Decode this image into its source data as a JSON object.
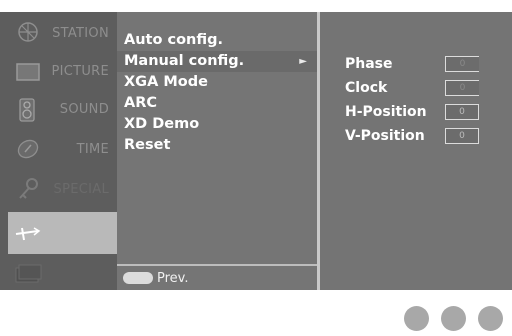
{
  "sidebar": {
    "items": [
      {
        "label": "STATION",
        "icon": "station-antenna-icon"
      },
      {
        "label": "PICTURE",
        "icon": "picture-screen-icon"
      },
      {
        "label": "SOUND",
        "icon": "speaker-icon"
      },
      {
        "label": "TIME",
        "icon": "clock-icon"
      },
      {
        "label": "SPECIAL",
        "icon": "key-icon"
      },
      {
        "label": "",
        "icon": "screen-tool-icon"
      },
      {
        "label": "",
        "icon": "window-icon"
      }
    ],
    "active_index": 5
  },
  "menu": {
    "items": [
      {
        "label": "Auto config."
      },
      {
        "label": "Manual config.",
        "arrow": "►"
      },
      {
        "label": "XGA Mode"
      },
      {
        "label": "ARC"
      },
      {
        "label": "XD Demo"
      },
      {
        "label": "Reset"
      }
    ],
    "selected_index": 1,
    "prev_label": "Prev."
  },
  "settings": {
    "rows": [
      {
        "label": "Phase",
        "value": "0"
      },
      {
        "label": "Clock",
        "value": "0"
      },
      {
        "label": "H-Position",
        "value": "0"
      },
      {
        "label": "V-Position",
        "value": "0"
      }
    ]
  },
  "colors": {
    "osd_background": "#5d5d5d",
    "active_sidebar": "#b9b9b9",
    "dot": "#a8a8a8"
  }
}
